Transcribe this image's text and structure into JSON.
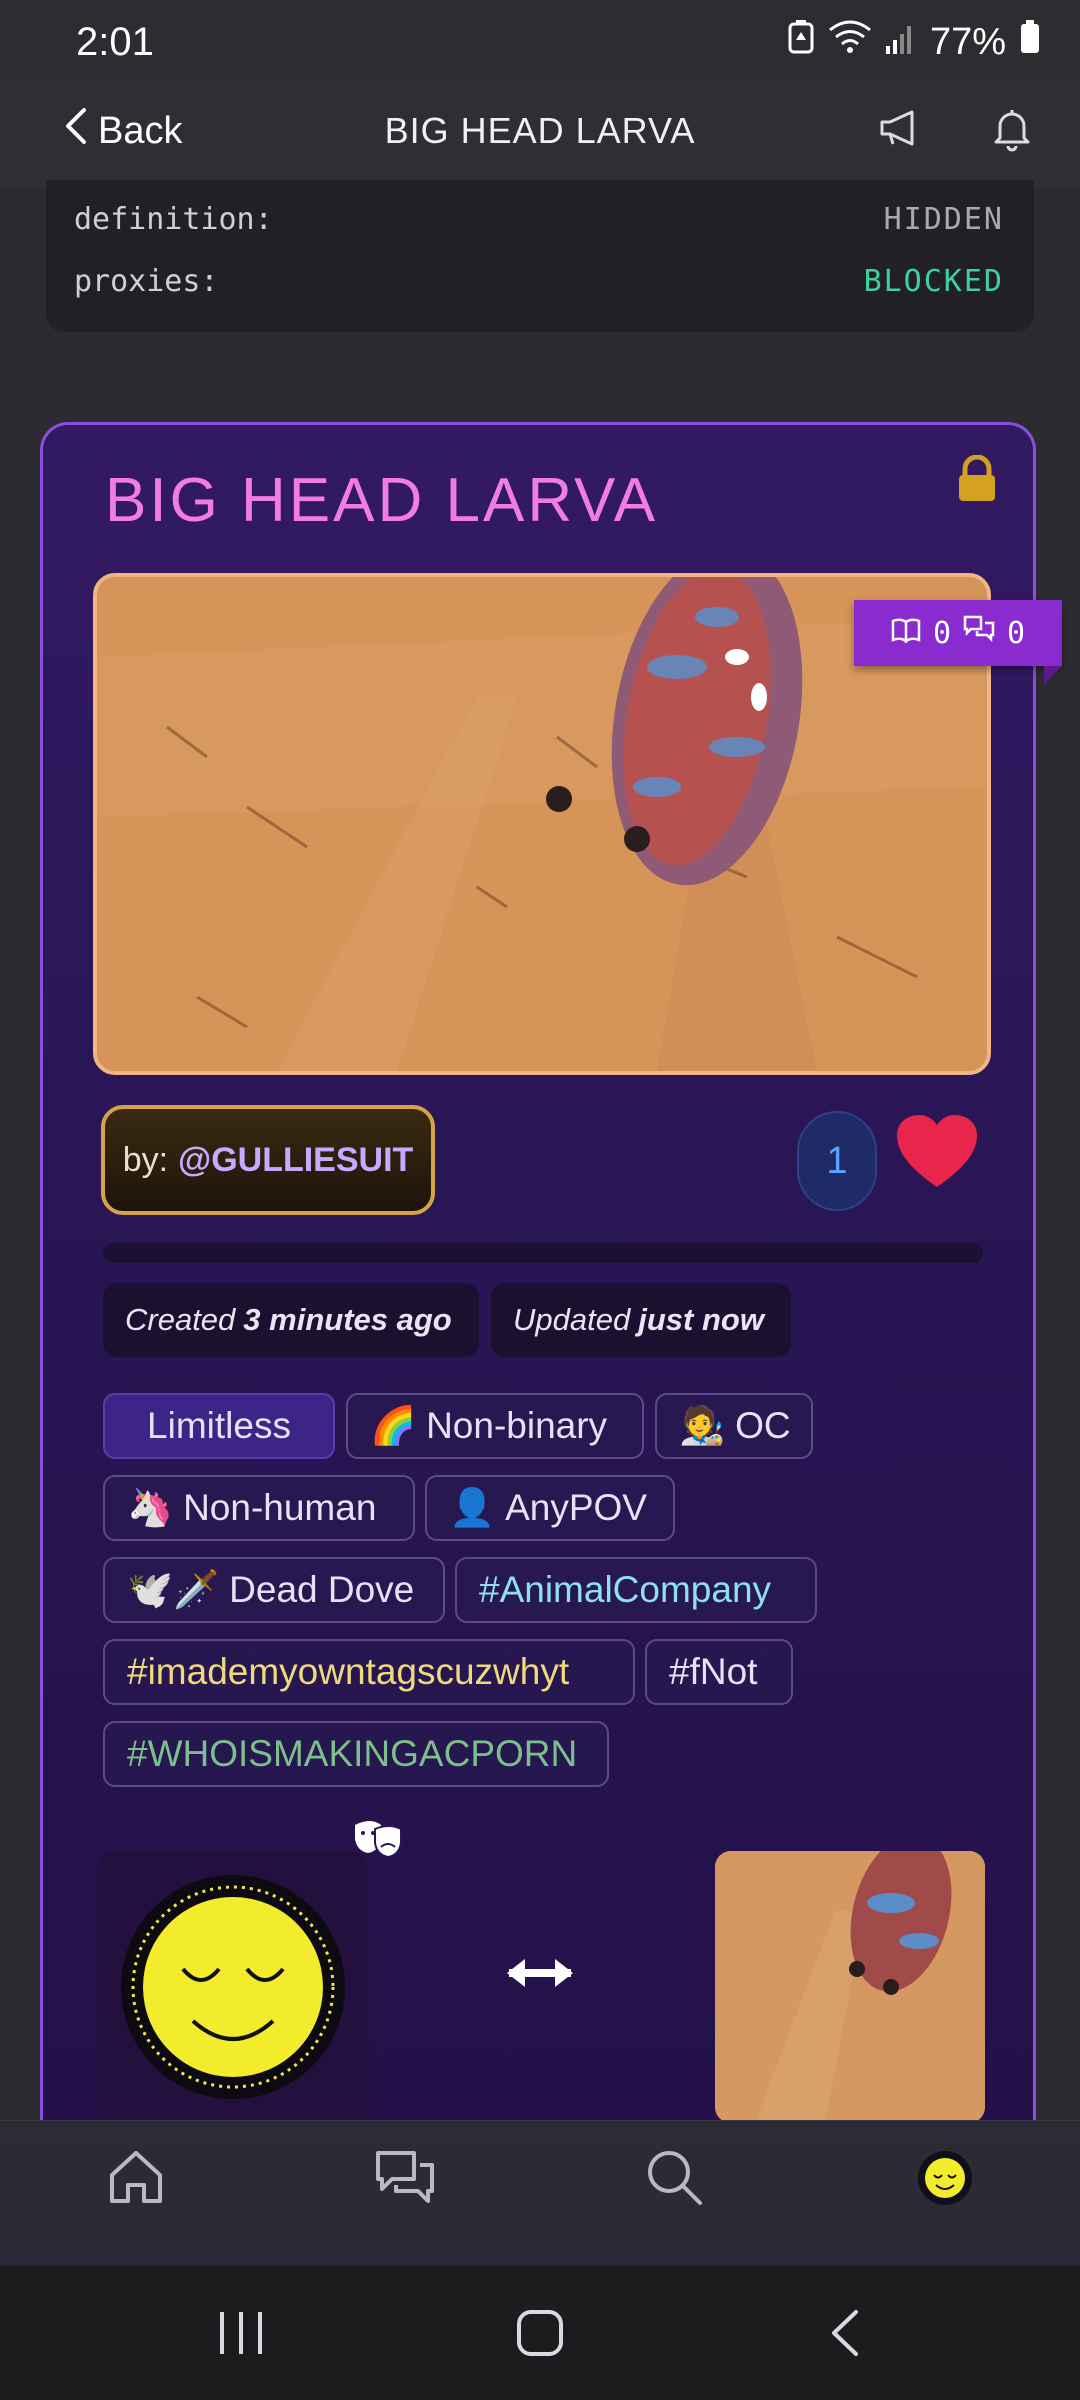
{
  "status_bar": {
    "time": "2:01",
    "battery_percent": "77%"
  },
  "top_bar": {
    "back_label": "Back",
    "title": "BIG HEAD LARVA"
  },
  "info": [
    {
      "key": "definition:",
      "value": "HIDDEN"
    },
    {
      "key": "proxies:",
      "value": "BLOCKED"
    }
  ],
  "card": {
    "title": "BIG HEAD LARVA",
    "stats": {
      "reads": "0",
      "chats": "0"
    },
    "byline_prefix": "by:",
    "author": "@GULLIESUIT",
    "likes": "1",
    "created_prefix": "Created",
    "created_value": "3 minutes ago",
    "updated_prefix": "Updated",
    "updated_value": "just now",
    "tags": [
      {
        "label": "Limitless",
        "emoji": ""
      },
      {
        "label": "Non-binary",
        "emoji": "🌈"
      },
      {
        "label": "OC",
        "emoji": "🧑‍🎨"
      },
      {
        "label": "Non-human",
        "emoji": "🦄"
      },
      {
        "label": "AnyPOV",
        "emoji": "👤"
      },
      {
        "label": "Dead Dove",
        "emoji": "🕊️🗡️"
      },
      {
        "label": "#AnimalCompany",
        "emoji": ""
      },
      {
        "label": "#imademyowntagscuzwhyt",
        "emoji": ""
      },
      {
        "label": "#fNot",
        "emoji": ""
      },
      {
        "label": "#WHOISMAKINGACPORN",
        "emoji": ""
      }
    ]
  },
  "icons": {
    "accent": "#8b4fe0",
    "title_color": "#f27de0",
    "lock_color": "#d4a21e",
    "heart_color": "#e8254a"
  }
}
